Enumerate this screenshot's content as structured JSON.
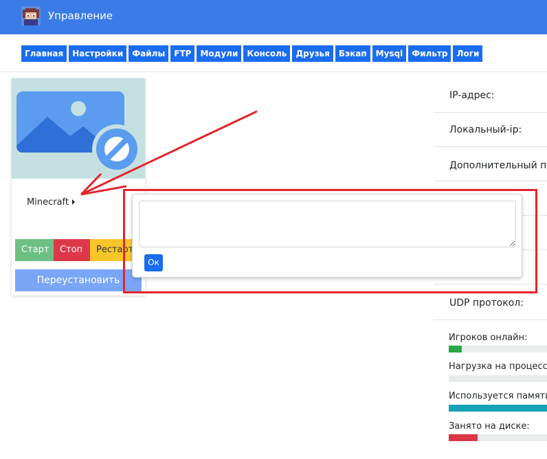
{
  "header": {
    "title": "Управление",
    "accent_color": "#3a7be8"
  },
  "nav": {
    "items": [
      "Главная",
      "Настройки",
      "Файлы",
      "FTP",
      "Модули",
      "Консоль",
      "Друзья",
      "Бэкап",
      "Mysql",
      "Фильтр",
      "Логи"
    ]
  },
  "server_card": {
    "image_icon": "image-placeholder-icon",
    "game_name": "Minecraft",
    "start_label": "Старт",
    "stop_label": "Стоп",
    "restart_label": "Рестарт",
    "reinstall_label": "Переустановить"
  },
  "info": {
    "ip_label": "IP-адрес:",
    "local_ip_label": "Локальный-ip:",
    "extra_port_label": "Дополнительный порт:",
    "udp_label": "UDP протокол:"
  },
  "stats": {
    "players_label": "Игроков онлайн:",
    "players_color": "#28a745",
    "cpu_label": "Нагрузка на процессор:",
    "memory_label": "Используется памяти:",
    "memory_color": "#17a2b8",
    "disk_label": "Занято на диске:",
    "disk_color": "#dc3545"
  },
  "dialog": {
    "textarea_value": "",
    "ok_label": "Ок"
  }
}
